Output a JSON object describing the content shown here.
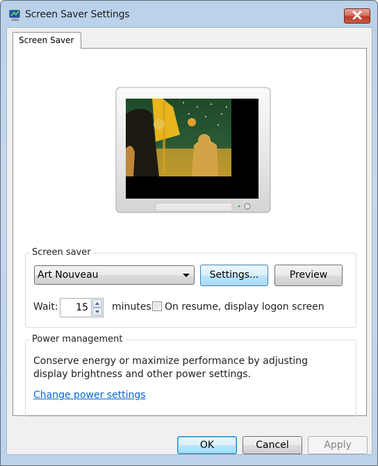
{
  "window": {
    "title": "Screen Saver Settings",
    "icon": "display-settings-icon",
    "close_icon": "close-icon"
  },
  "tabs": [
    {
      "label": "Screen Saver",
      "selected": true
    }
  ],
  "preview": {
    "screensaver_image": "klimt-music-painting"
  },
  "screen_saver_group": {
    "label": "Screen saver",
    "selected": "Art Nouveau",
    "settings_label": "Settings...",
    "preview_label": "Preview",
    "wait_label": "Wait:",
    "wait_value": "15",
    "minutes_label": "minutes",
    "on_resume_label": "On resume, display logon screen",
    "on_resume_checked": false
  },
  "power_group": {
    "label": "Power management",
    "description_line1": "Conserve energy or maximize performance by adjusting",
    "description_line2": "display brightness and other power settings.",
    "link_label": "Change power settings"
  },
  "footer": {
    "ok_label": "OK",
    "cancel_label": "Cancel",
    "apply_label": "Apply"
  },
  "colors": {
    "link": "#0066cc",
    "frame": "#b9d1ea",
    "close_button": "#c9442e"
  }
}
